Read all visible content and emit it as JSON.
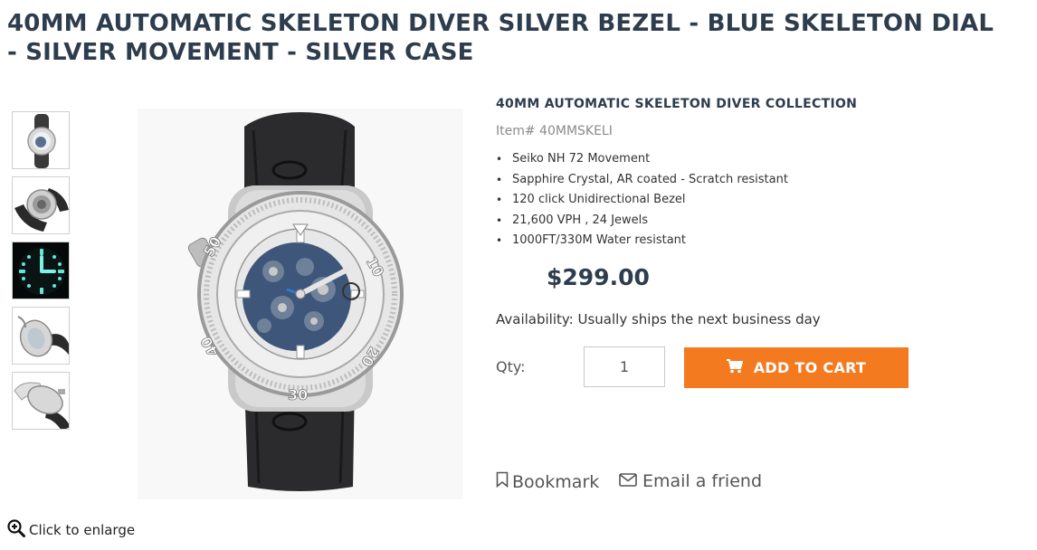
{
  "product": {
    "title": "40MM AUTOMATIC SKELETON DIVER SILVER BEZEL - BLUE SKELETON DIAL - SILVER MOVEMENT - SILVER CASE",
    "collection": "40MM AUTOMATIC SKELETON DIVER COLLECTION",
    "item_number": "Item# 40MMSKELI",
    "features": [
      "Seiko NH 72 Movement",
      "Sapphire Crystal, AR coated - Scratch resistant",
      "120 click Unidirectional Bezel",
      "21,600 VPH , 24 Jewels",
      "1000FT/330M Water resistant"
    ],
    "price": "$299.00",
    "availability": "Availability: Usually ships the next business day"
  },
  "gallery": {
    "enlarge_label": "Click to enlarge",
    "thumbnails": [
      "front view",
      "back view",
      "luminous dial",
      "side view",
      "crown side view"
    ]
  },
  "purchase": {
    "qty_label": "Qty:",
    "qty_value": "1",
    "add_to_cart_label": "ADD TO CART"
  },
  "actions": {
    "bookmark_label": "Bookmark",
    "email_label": "Email a friend"
  },
  "colors": {
    "accent": "#f47a20",
    "title": "#2e3d4e"
  }
}
